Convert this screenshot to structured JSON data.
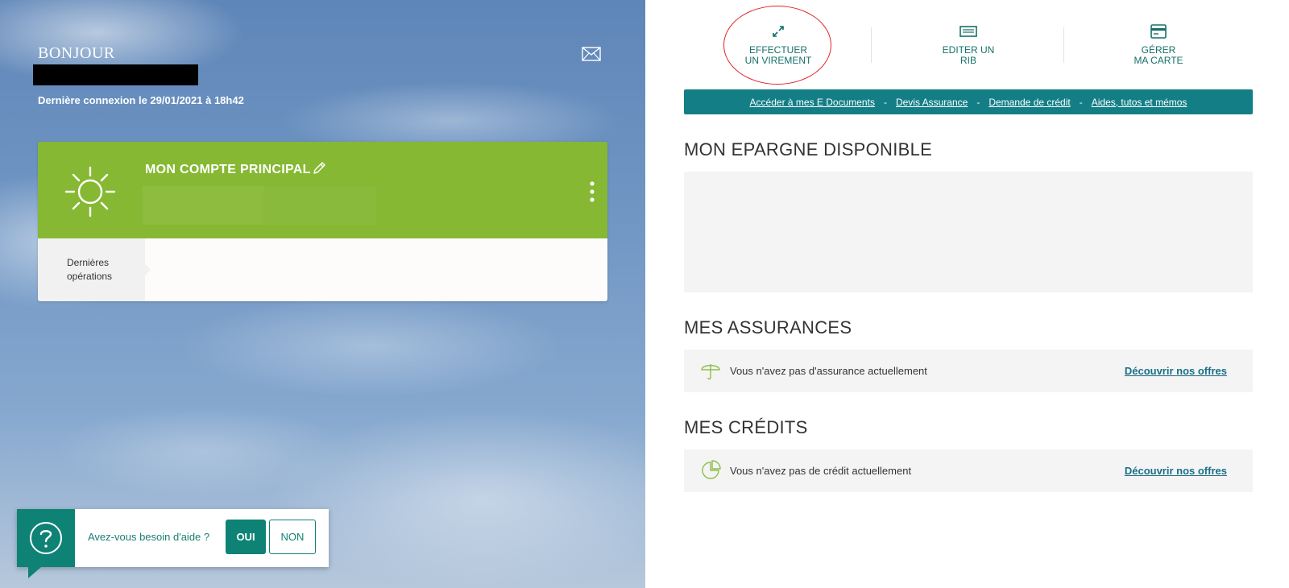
{
  "left": {
    "greeting": "BONJOUR",
    "last_login": "Dernière connexion le 29/01/2021 à 18h42",
    "account": {
      "title": "MON COMPTE PRINCIPAL",
      "ops_label": "Dernières opérations"
    },
    "help": {
      "question": "Avez-vous besoin d'aide ?",
      "yes": "OUI",
      "no": "NON"
    }
  },
  "right": {
    "quick_actions": [
      {
        "line1": "EFFECTUER",
        "line2": "UN VIREMENT",
        "icon": "transfer-icon"
      },
      {
        "line1": "EDITER UN",
        "line2": "RIB",
        "icon": "rib-icon"
      },
      {
        "line1": "GÉRER",
        "line2": "MA CARTE",
        "icon": "card-icon"
      }
    ],
    "links": [
      "Accéder à mes E Documents",
      "Devis Assurance",
      "Demande de crédit",
      "Aides, tutos et mémos"
    ],
    "link_separator": "-",
    "sections": {
      "epargne_title": "MON EPARGNE DISPONIBLE",
      "assurances_title": "MES ASSURANCES",
      "assurances_text": "Vous n'avez pas d'assurance actuellement",
      "assurances_link": "Découvrir nos offres",
      "credits_title": "MES CRÉDITS",
      "credits_text": "Vous n'avez pas de crédit actuellement",
      "credits_link": "Découvrir nos offres"
    }
  },
  "colors": {
    "brand_teal": "#0f8276",
    "account_green": "#86b833",
    "links_bar": "#147e86",
    "highlight_red": "#e02424"
  }
}
